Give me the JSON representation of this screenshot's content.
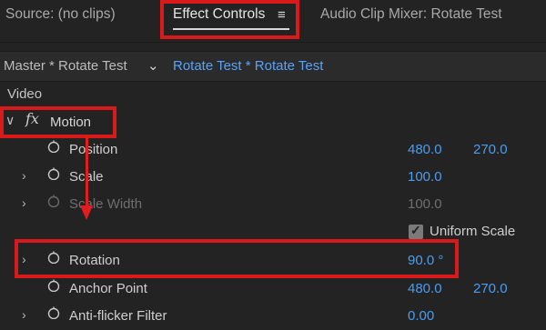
{
  "tabs": {
    "source": "Source: (no clips)",
    "effect_controls": "Effect Controls",
    "audio_mixer": "Audio Clip Mixer: Rotate Test",
    "menu_icon": "≡"
  },
  "sequence": {
    "master": "Master * Rotate Test",
    "active": "Rotate Test * Rotate Test",
    "chevron": "⌄"
  },
  "section": "Video",
  "effect": {
    "fx_symbol": "fx",
    "name": "Motion"
  },
  "properties": [
    {
      "label": "Position",
      "v1": "480.0",
      "v2": "270.0"
    },
    {
      "label": "Scale",
      "v1": "100.0"
    },
    {
      "label": "Scale Width",
      "v1": "100.0"
    },
    {
      "label": "Rotation",
      "v1": "90.0 °"
    },
    {
      "label": "Anchor Point",
      "v1": "480.0",
      "v2": "270.0"
    },
    {
      "label": "Anti-flicker Filter",
      "v1": "0.00"
    }
  ],
  "uniform_scale": "Uniform Scale",
  "colors": {
    "background": "#232323",
    "value_blue": "#4a9df2",
    "highlight_red": "#d91a1a"
  }
}
